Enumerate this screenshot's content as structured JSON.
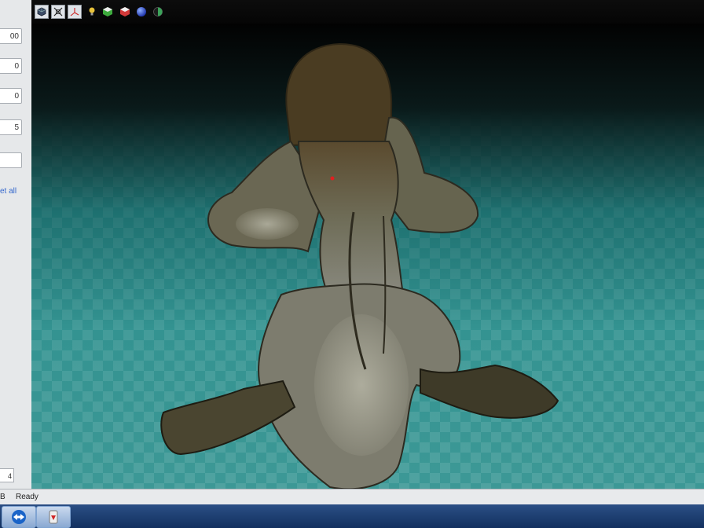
{
  "left_panel": {
    "fields": [
      "00",
      "0",
      "0",
      "5",
      ""
    ],
    "reset_label": "et all",
    "bottom_value": "4"
  },
  "toolbar": {
    "icons": [
      "cube-view-icon",
      "fit-view-icon",
      "axes-icon",
      "light-icon",
      "green-cube-icon",
      "red-cube-icon",
      "sphere-icon",
      "shading-icon"
    ]
  },
  "viewport": {
    "object": "3d-vertebra-model"
  },
  "statusbar": {
    "size_fragment": "B",
    "status_text": "Ready"
  },
  "taskbar": {
    "apps": [
      "teamviewer-icon",
      "app-icon"
    ]
  },
  "colors": {
    "viewport_teal": "#2a8b8a",
    "toolbar_bg": "#050505",
    "taskbar_blue": "#1f3f73",
    "link_blue": "#3366cc"
  }
}
